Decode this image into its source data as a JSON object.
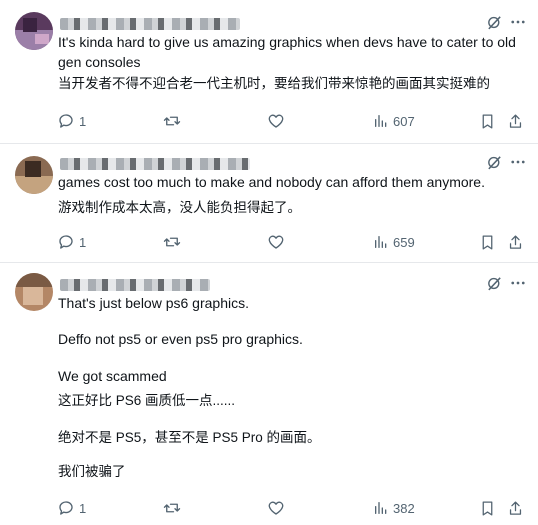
{
  "colors": {
    "text": "#0f1419",
    "muted": "#536471",
    "divider": "#e6e8eb"
  },
  "posts": [
    {
      "partial_lead": "It's kinda hard to give us amazing graphics when devs have to cater to old gen consoles",
      "lines": [
        "It's kinda hard to give us amazing graphics when devs have to cater to old",
        "gen consoles",
        "当开发者不得不迎合老一代主机时，要给我们带来惊艳的画面其实挺难的"
      ],
      "replies": "1",
      "views": "607"
    },
    {
      "lines": [
        "games cost too much to make and nobody can afford them anymore.",
        "游戏制作成本太高，没人能负担得起了。"
      ],
      "replies": "1",
      "views": "659"
    },
    {
      "lines": [
        "That's just below ps6 graphics.",
        "Deffo not ps5 or even ps5 pro graphics.",
        "We got scammed",
        "这正好比 PS6 画质低一点......",
        "绝对不是 PS5，甚至不是 PS5 Pro 的画面。",
        "我们被骗了"
      ],
      "replies": "1",
      "views": "382"
    }
  ],
  "icons": [
    "grok-icon",
    "more-icon",
    "reply-icon",
    "retweet-icon",
    "like-icon",
    "views-icon",
    "bookmark-icon",
    "share-icon"
  ]
}
